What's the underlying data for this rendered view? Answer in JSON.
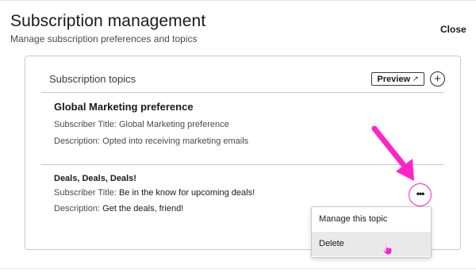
{
  "page": {
    "title": "Subscription management",
    "subtitle": "Manage subscription preferences and topics",
    "close_label": "Close"
  },
  "topics_panel": {
    "title": "Subscription topics",
    "preview_label": "Preview",
    "preview_icon": "external-link-icon",
    "add_icon": "plus-circle-icon",
    "add_symbol": "+",
    "external_symbol": "↗"
  },
  "topics": [
    {
      "name": "Global Marketing preference",
      "subscriber_title_label": "Subscriber Title:",
      "subscriber_title": "Global Marketing preference",
      "description_label": "Description:",
      "description": "Opted into receiving marketing emails"
    },
    {
      "name": "Deals, Deals, Deals!",
      "subscriber_title_label": "Subscriber Title:",
      "subscriber_title": "Be in the know for upcoming deals!",
      "description_label": "Description:",
      "description": "Get the deals, friend!"
    }
  ],
  "more_menu": {
    "icon": "more-horizontal-icon",
    "symbol": "•••",
    "items": [
      {
        "label": "Manage this topic"
      },
      {
        "label": "Delete"
      }
    ]
  },
  "colors": {
    "annotation_arrow": "#ff23c8",
    "menu_hover": "#e9e9e9",
    "border": "#c9c9c9"
  }
}
